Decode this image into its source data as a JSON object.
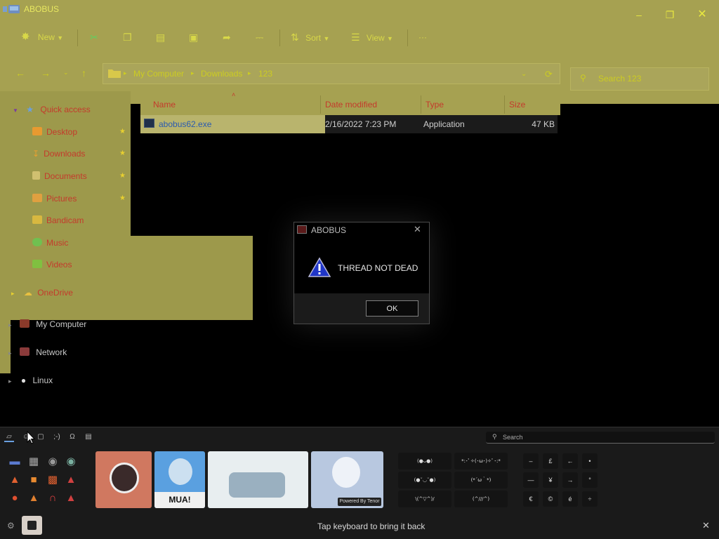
{
  "window": {
    "title": "ABOBUS",
    "accent": "#a6a151"
  },
  "toolbar": {
    "new_label": "New",
    "sort_label": "Sort",
    "view_label": "View",
    "more_label": "···"
  },
  "address": {
    "crumbs": [
      "My Computer",
      "Downloads",
      "123"
    ],
    "search_placeholder": "Search 123"
  },
  "nav": {
    "quick_access": "Quick access",
    "items": [
      {
        "label": "Desktop",
        "pinned": true
      },
      {
        "label": "Downloads",
        "pinned": true
      },
      {
        "label": "Documents",
        "pinned": true
      },
      {
        "label": "Pictures",
        "pinned": true
      },
      {
        "label": "Bandicam",
        "pinned": false
      },
      {
        "label": "Music",
        "pinned": false
      },
      {
        "label": "Videos",
        "pinned": false
      }
    ],
    "onedrive": "OneDrive",
    "my_computer": "My Computer",
    "network": "Network",
    "linux": "Linux"
  },
  "files": {
    "columns": [
      "Name",
      "Date modified",
      "Type",
      "Size"
    ],
    "rows": [
      {
        "name": "abobus62.exe",
        "date": "2/16/2022 7:23 PM",
        "type": "Application",
        "size": "47 KB"
      }
    ]
  },
  "dialog": {
    "title": "ABOBUS",
    "message": "THREAD NOT DEAD",
    "ok_label": "OK"
  },
  "panel": {
    "search_placeholder": "Search",
    "gif_caption": "MUA!",
    "tenor_label": "Powered By Tenor",
    "kaomoji": [
      "(●ᴗ●)",
      "*:･ﾟ✧(･ω･)✧ﾟ･:*",
      "(●˘◡˘●)",
      "(*´ω｀*)",
      "\\(^▽^)/",
      "(^///^)"
    ],
    "symbols": [
      "–",
      "£",
      "←",
      "•",
      "—",
      "¥",
      "→",
      "°",
      "€",
      "©",
      "é",
      "÷"
    ],
    "hint": "Tap keyboard to bring it back"
  }
}
